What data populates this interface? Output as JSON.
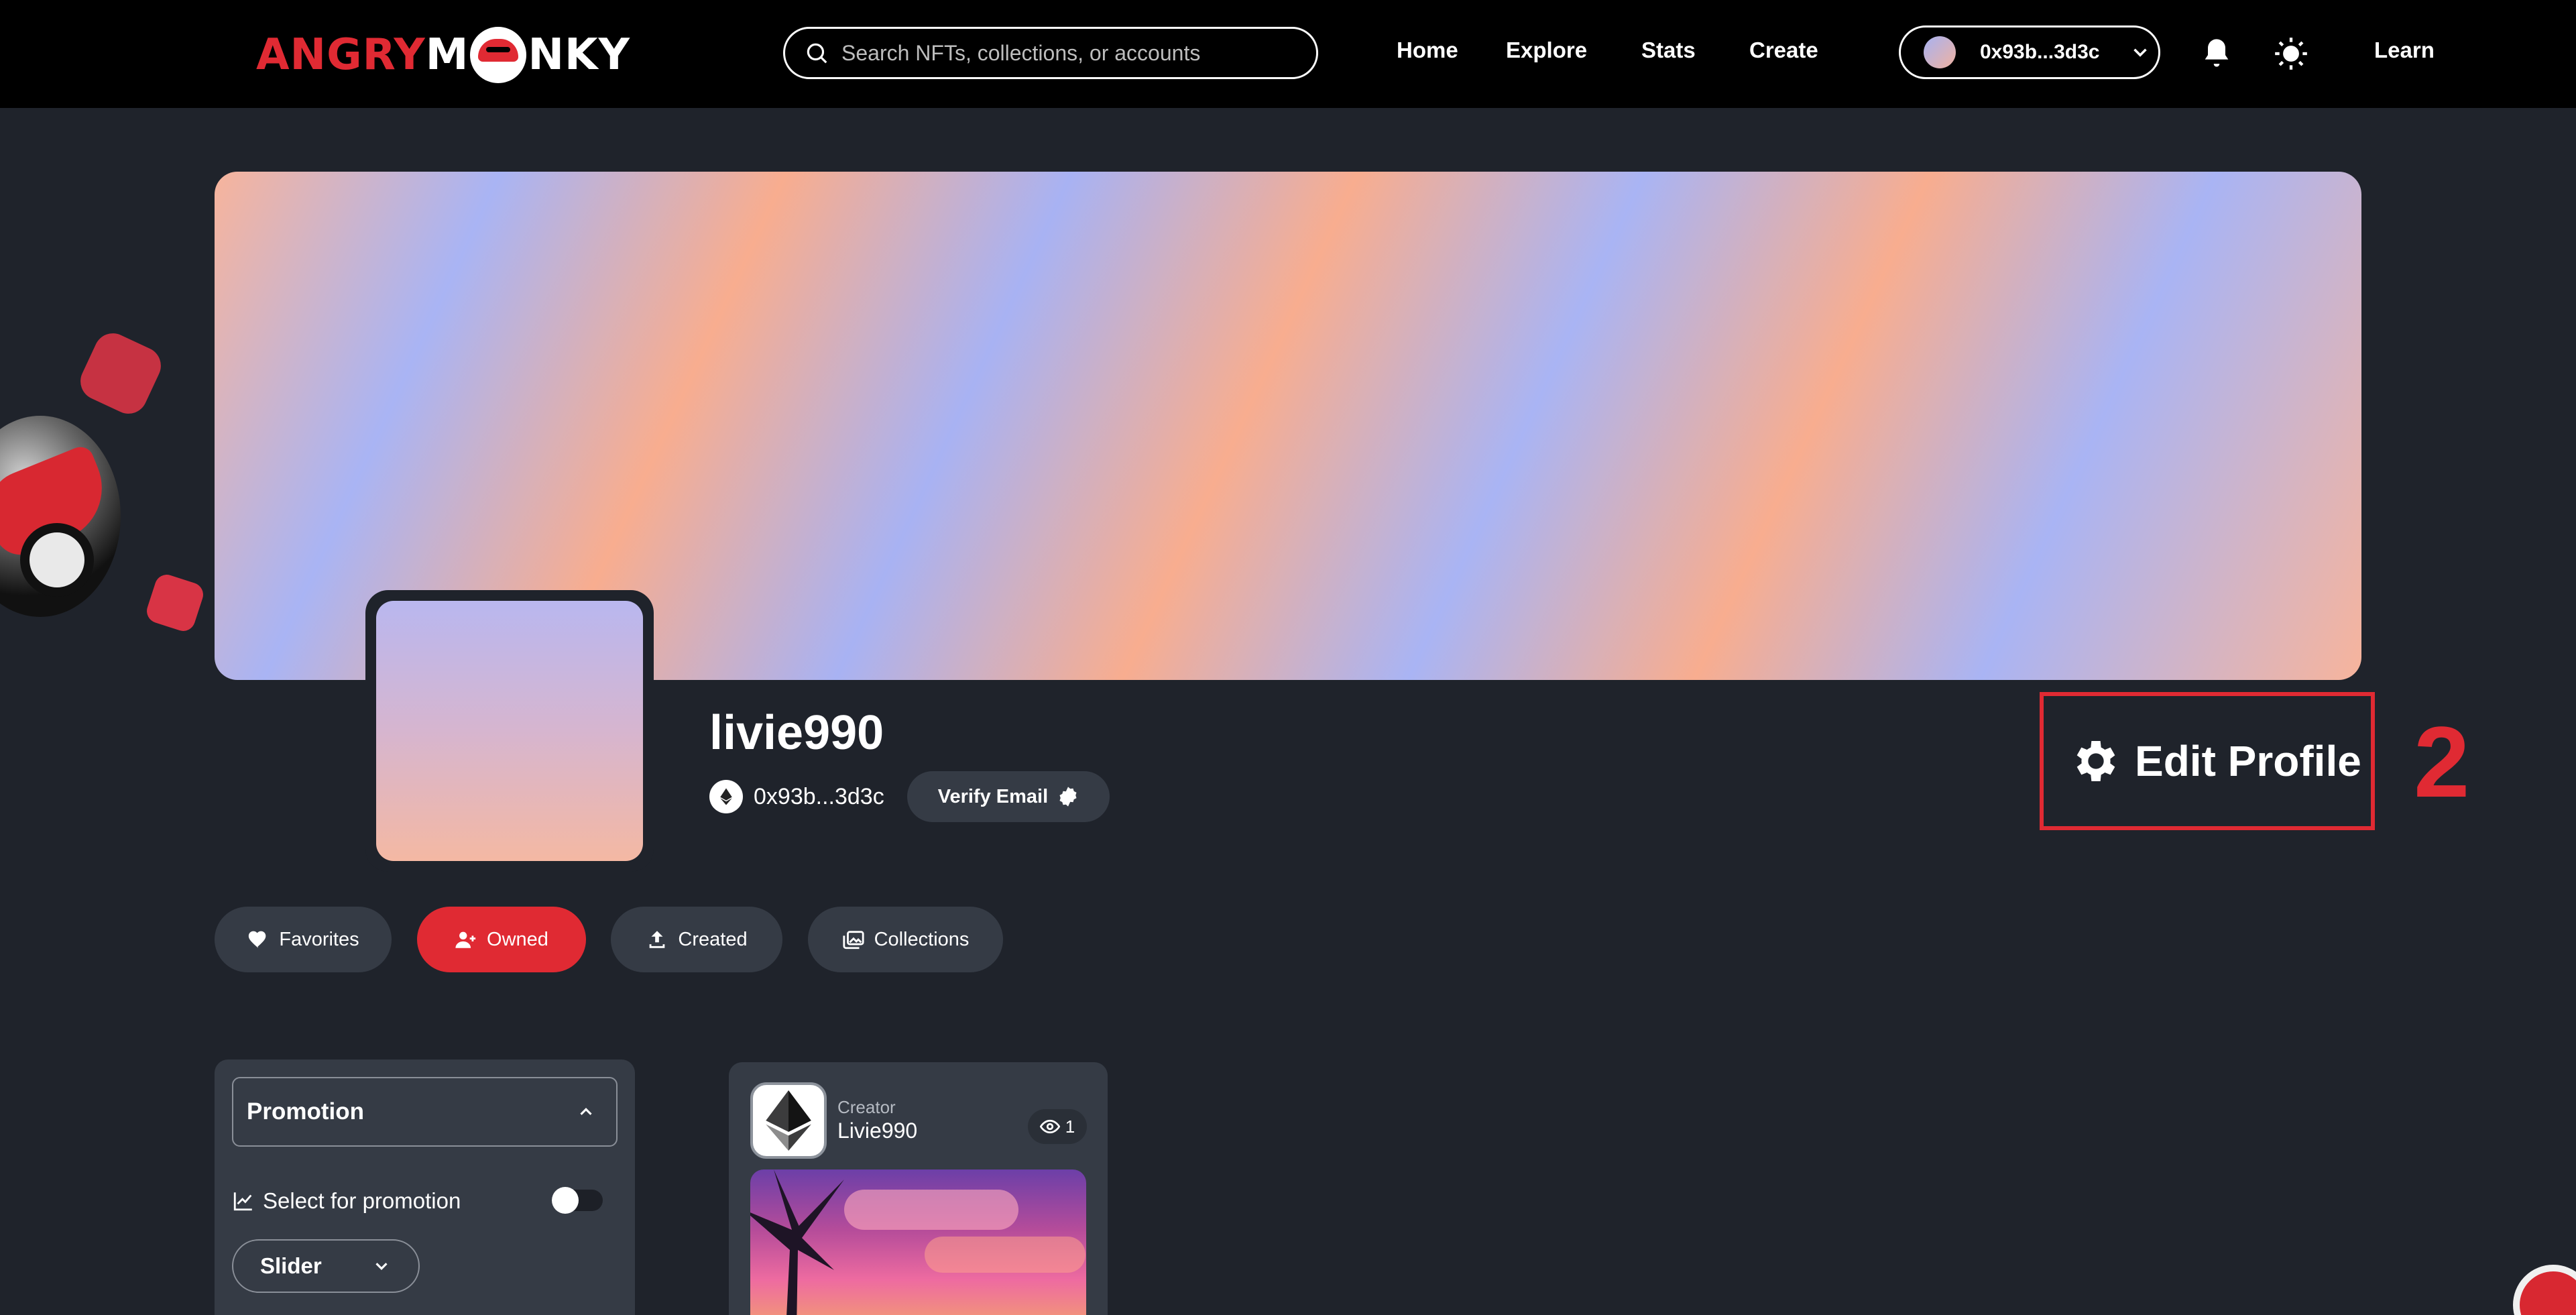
{
  "header": {
    "logo": {
      "part1": "ANGRY",
      "part2": "M",
      "part3": "NKY"
    },
    "search_placeholder": "Search NFTs, collections, or accounts",
    "nav": [
      "Home",
      "Explore",
      "Stats",
      "Create"
    ],
    "wallet_address": "0x93b...3d3c",
    "learn_label": "Learn"
  },
  "profile": {
    "username": "livie990",
    "address": "0x93b...3d3c",
    "verify_email_label": "Verify Email",
    "edit_profile_label": "Edit Profile",
    "step_number": "2"
  },
  "tabs": [
    {
      "label": "Favorites",
      "icon": "heart-icon",
      "active": false
    },
    {
      "label": "Owned",
      "icon": "user-icon",
      "active": true
    },
    {
      "label": "Created",
      "icon": "upload-icon",
      "active": false
    },
    {
      "label": "Collections",
      "icon": "images-icon",
      "active": false
    }
  ],
  "filters": {
    "promotion_title": "Promotion",
    "select_promotion_label": "Select for promotion",
    "select_promotion_enabled": false,
    "display_type": "Slider"
  },
  "nft_card": {
    "creator_label": "Creator",
    "creator_name": "Livie990",
    "views": "1"
  },
  "colors": {
    "accent": "#e02a33",
    "background": "#1f232b",
    "panel": "#353b45",
    "topbar": "#000000"
  }
}
